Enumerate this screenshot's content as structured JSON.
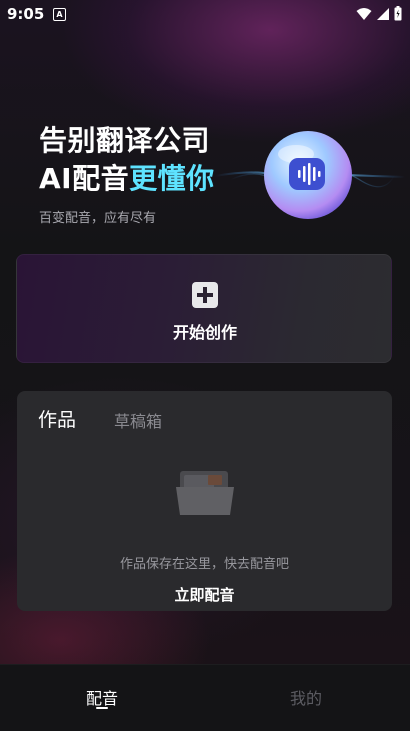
{
  "status_bar": {
    "time": "9:05",
    "notification_icon": "A"
  },
  "hero": {
    "title_line1": "告别翻译公司",
    "title_line2_prefix": "AI配音",
    "title_line2_highlight": "更懂你",
    "subtitle": "百变配音，应有尽有",
    "highlight_color": "#5ee3ff"
  },
  "create_card": {
    "label": "开始创作"
  },
  "works_panel": {
    "tabs": [
      {
        "label": "作品",
        "active": true
      },
      {
        "label": "草稿箱",
        "active": false
      }
    ],
    "empty_text": "作品保存在这里，快去配音吧",
    "action_label": "立即配音"
  },
  "bottom_nav": {
    "items": [
      {
        "label": "配音",
        "active": true
      },
      {
        "label": "我的",
        "active": false
      }
    ]
  }
}
